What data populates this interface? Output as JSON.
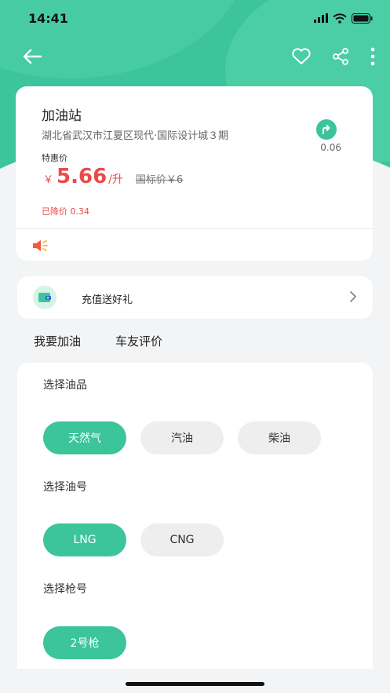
{
  "status_bar": {
    "time": "14:41"
  },
  "station": {
    "name": "加油站",
    "address": "湖北省武汉市江夏区现代·国际设计城３期",
    "distance": "0.06",
    "promo_label": "特惠价",
    "currency": "￥",
    "price": "5.66",
    "unit": "/升",
    "list_price": "国标价￥6",
    "price_drop": "已降价 0.34"
  },
  "recharge": {
    "label": "充值送好礼"
  },
  "tabs": [
    {
      "label": "我要加油"
    },
    {
      "label": "车友评价"
    }
  ],
  "sections": {
    "fuel_type": {
      "title": "选择油品",
      "options": [
        "天然气",
        "汽油",
        "柴油"
      ],
      "selected": "天然气"
    },
    "fuel_grade": {
      "title": "选择油号",
      "options": [
        "LNG",
        "CNG"
      ],
      "selected": "LNG"
    },
    "nozzle": {
      "title": "选择枪号",
      "options": [
        "2号枪"
      ],
      "selected": "2号枪"
    }
  },
  "colors": {
    "accent": "#3cc49a",
    "price": "#e94b49",
    "background": "#f3f4f6"
  },
  "icons": [
    "back-arrow-icon",
    "heart-icon",
    "share-icon",
    "more-icon",
    "navigate-icon",
    "speaker-icon",
    "wallet-icon",
    "chevron-right-icon"
  ]
}
